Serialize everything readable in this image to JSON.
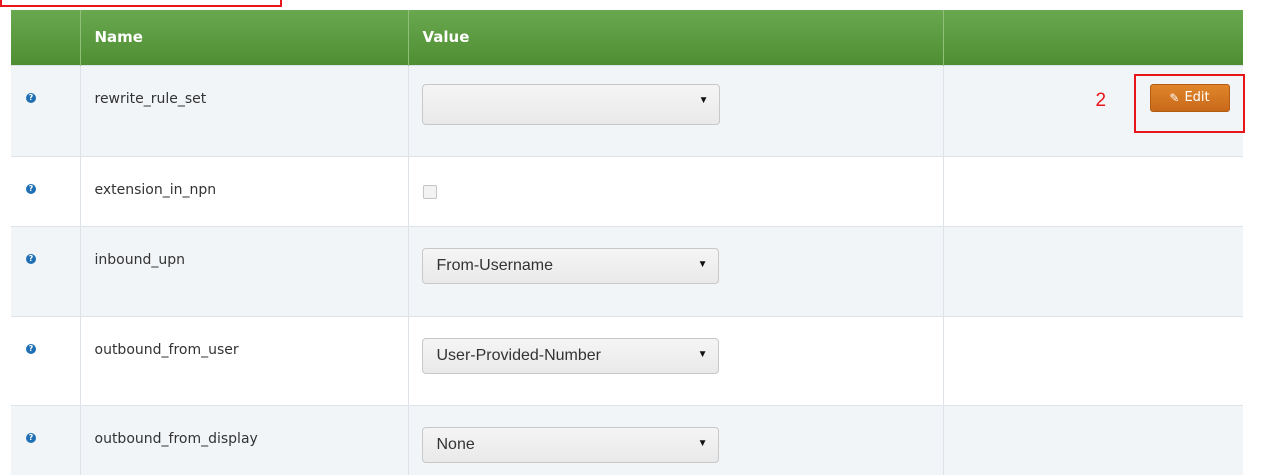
{
  "table": {
    "headers": [
      "",
      "Name",
      "Value",
      ""
    ],
    "rows": [
      {
        "name": "rewrite_rule_set",
        "type": "select",
        "value": "",
        "has_edit": true
      },
      {
        "name": "extension_in_npn",
        "type": "checkbox",
        "checked": false
      },
      {
        "name": "inbound_upn",
        "type": "select",
        "value": "From-Username"
      },
      {
        "name": "outbound_from_user",
        "type": "select",
        "value": "User-Provided-Number"
      },
      {
        "name": "outbound_from_display",
        "type": "select",
        "value": "None"
      }
    ]
  },
  "edit_button": {
    "label": "Edit",
    "step_marker": "2"
  },
  "icons": {
    "help": "help-circle-icon",
    "edit": "pencil-square-icon",
    "dropdown": "caret-down-icon"
  },
  "colors": {
    "header_green": "#5a9a3c",
    "edit_orange": "#d4761f",
    "annotation_red": "#e8151b",
    "help_blue": "#1f6fb5"
  }
}
